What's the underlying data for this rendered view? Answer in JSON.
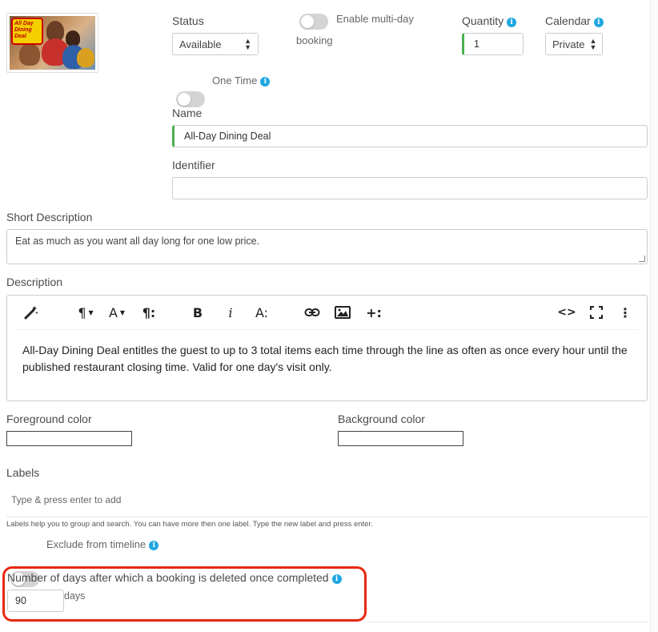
{
  "image": {
    "badge_text": "All Day Dining Deal"
  },
  "status": {
    "label": "Status",
    "value": "Available"
  },
  "multiday": {
    "label_line1": "Enable multi-day",
    "label_line2": "booking"
  },
  "quantity": {
    "label": "Quantity",
    "value": "1"
  },
  "calendar": {
    "label": "Calendar",
    "value": "Private"
  },
  "one_time": {
    "label": "One Time"
  },
  "name": {
    "label": "Name",
    "value": "All-Day Dining Deal"
  },
  "identifier": {
    "label": "Identifier",
    "value": ""
  },
  "short_description": {
    "label": "Short Description",
    "value": "Eat as much as you want all day long for one low price."
  },
  "description": {
    "label": "Description",
    "body": "All-Day Dining Deal entitles the guest to up to 3 total items each time through the line as often as once every hour until the published restaurant closing time. Valid for one day's visit only.",
    "toolbar": {
      "magic": "magic-wand-icon",
      "paragraph_format": "¶",
      "font_size": "A",
      "paragraph_style": "¶:",
      "bold": "B",
      "italic": "i",
      "text_style": "A:",
      "link": "link-icon",
      "image": "image-icon",
      "insert_more": "+:",
      "code_view": "<>",
      "fullscreen": "fullscreen-icon",
      "more": "⋮"
    }
  },
  "colors": {
    "foreground_label": "Foreground color",
    "background_label": "Background color"
  },
  "labels": {
    "label": "Labels",
    "placeholder": "Type & press enter to add",
    "hint": "Labels help you to group and search. You can have more then one label. Type the new label and press enter."
  },
  "exclude_timeline": {
    "label": "Exclude from timeline"
  },
  "deletion": {
    "label": "Number of days after which a booking is deleted once completed",
    "value": "90",
    "unit": "days"
  },
  "theme": {
    "accent_green": "#4caf50",
    "info_blue": "#1ea7e1",
    "highlight_red": "#e8280f"
  }
}
